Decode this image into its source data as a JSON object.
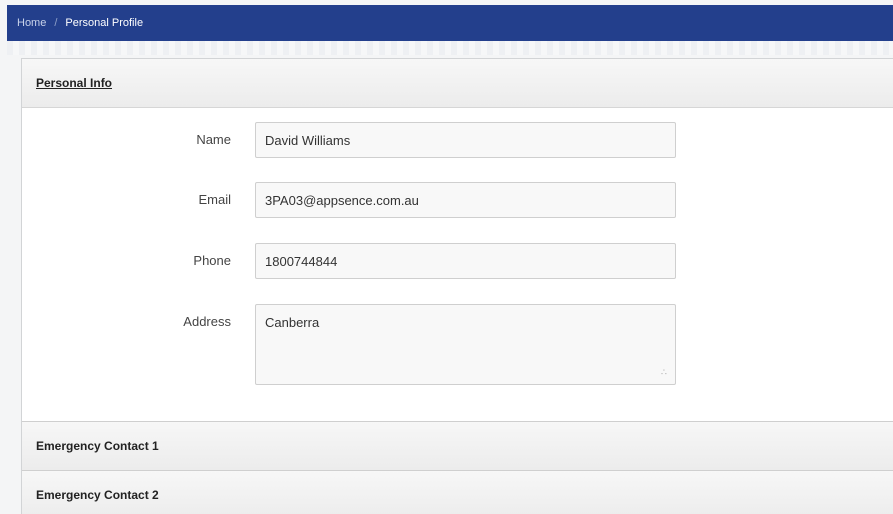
{
  "breadcrumb": {
    "home": "Home",
    "separator": "/",
    "current": "Personal Profile"
  },
  "sections": {
    "personal_info": "Personal Info",
    "emergency_1": "Emergency Contact 1",
    "emergency_2": "Emergency Contact 2"
  },
  "form": {
    "name": {
      "label": "Name",
      "value": "David Williams"
    },
    "email": {
      "label": "Email",
      "value": "3PA03@appsence.com.au"
    },
    "phone": {
      "label": "Phone",
      "value": "1800744844"
    },
    "address": {
      "label": "Address",
      "value": "Canberra"
    }
  },
  "colors": {
    "topbar": "#233f8c"
  }
}
